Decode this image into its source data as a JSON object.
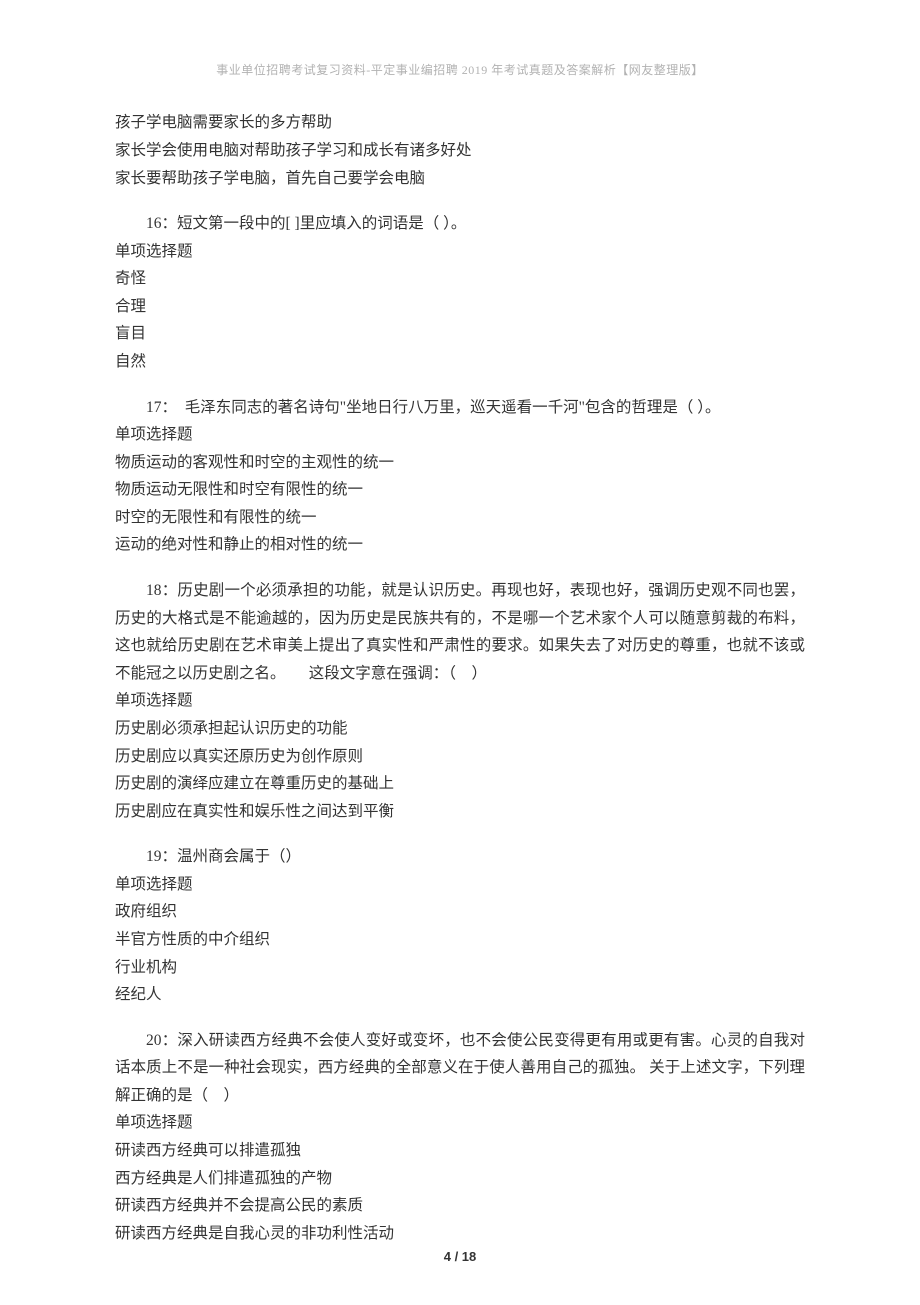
{
  "header": "事业单位招聘考试复习资料-平定事业编招聘 2019 年考试真题及答案解析【网友整理版】",
  "intro": {
    "line1": "孩子学电脑需要家长的多方帮助",
    "line2": "家长学会使用电脑对帮助孩子学习和成长有诸多好处",
    "line3": "家长要帮助孩子学电脑，首先自己要学会电脑"
  },
  "q16": {
    "stem": "16：短文第一段中的[ ]里应填入的词语是（  ）。",
    "type": "单项选择题",
    "optA": "奇怪",
    "optB": "合理",
    "optC": "盲目",
    "optD": "自然"
  },
  "q17": {
    "stem": "17：　毛泽东同志的著名诗句\"坐地日行八万里，巡天遥看一千河\"包含的哲理是（  ）。",
    "type": "单项选择题",
    "optA": "物质运动的客观性和时空的主观性的统一",
    "optB": "物质运动无限性和时空有限性的统一",
    "optC": "时空的无限性和有限性的统一",
    "optD": "运动的绝对性和静止的相对性的统一"
  },
  "q18": {
    "stem": "18：历史剧一个必须承担的功能，就是认识历史。再现也好，表现也好，强调历史观不同也罢，历史的大格式是不能逾越的，因为历史是民族共有的，不是哪一个艺术家个人可以随意剪裁的布料，这也就给历史剧在艺术审美上提出了真实性和严肃性的要求。如果失去了对历史的尊重，也就不该或不能冠之以历史剧之名。　　这段文字意在强调：（　）",
    "type": "单项选择题",
    "optA": "历史剧必须承担起认识历史的功能",
    "optB": "历史剧应以真实还原历史为创作原则",
    "optC": "历史剧的演绎应建立在尊重历史的基础上",
    "optD": "历史剧应在真实性和娱乐性之间达到平衡"
  },
  "q19": {
    "stem": "19：温州商会属于（）",
    "type": "单项选择题",
    "optA": "政府组织",
    "optB": "半官方性质的中介组织",
    "optC": "行业机构",
    "optD": "经纪人"
  },
  "q20": {
    "stem": "20：深入研读西方经典不会使人变好或变坏，也不会使公民变得更有用或更有害。心灵的自我对话本质上不是一种社会现实，西方经典的全部意义在于使人善用自己的孤独。 关于上述文字，下列理解正确的是（　）",
    "type": "单项选择题",
    "optA": "研读西方经典可以排遣孤独",
    "optB": "西方经典是人们排遣孤独的产物",
    "optC": "研读西方经典并不会提高公民的素质",
    "optD": "研读西方经典是自我心灵的非功利性活动"
  },
  "footer": "4 / 18"
}
